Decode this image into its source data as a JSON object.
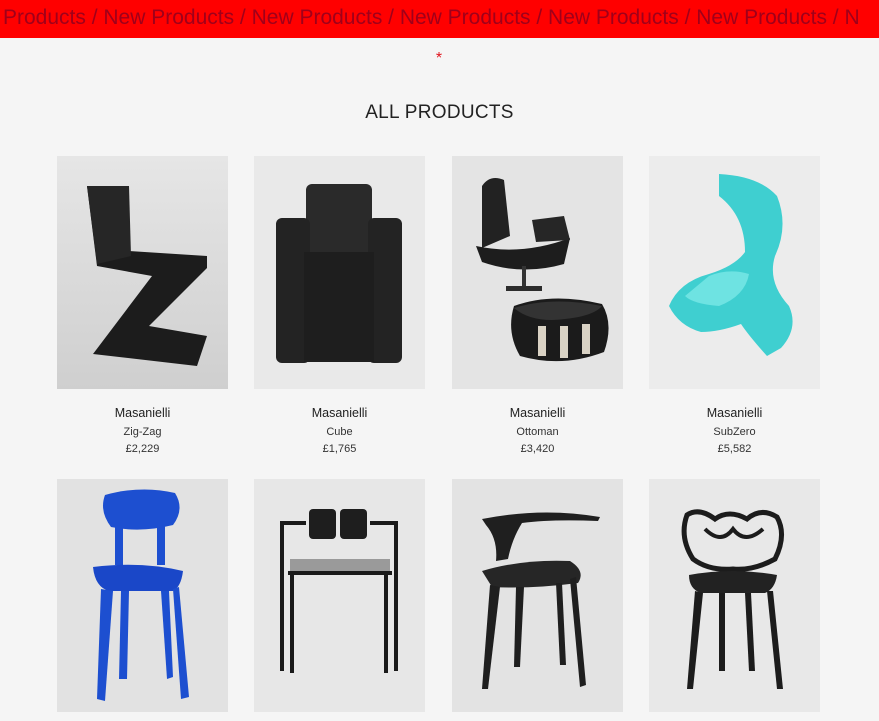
{
  "ticker": {
    "text": "w Products / New Products / New Products / New Products / New Products / New Products / N"
  },
  "marker": {
    "star": "*"
  },
  "section": {
    "title": "ALL PRODUCTS"
  },
  "products": [
    {
      "brand": "Masanielli",
      "name": "Zig-Zag",
      "price": "£2,229"
    },
    {
      "brand": "Masanielli",
      "name": "Cube",
      "price": "£1,765"
    },
    {
      "brand": "Masanielli",
      "name": "Ottoman",
      "price": "£3,420"
    },
    {
      "brand": "Masanielli",
      "name": "SubZero",
      "price": "£5,582"
    },
    {
      "brand": "",
      "name": "",
      "price": ""
    },
    {
      "brand": "",
      "name": "",
      "price": ""
    },
    {
      "brand": "",
      "name": "",
      "price": ""
    },
    {
      "brand": "",
      "name": "",
      "price": ""
    }
  ],
  "colors": {
    "ticker_bg": "#ff0000",
    "ticker_text": "#a0001a",
    "star": "#e0141e",
    "page_bg": "#f5f5f5"
  }
}
